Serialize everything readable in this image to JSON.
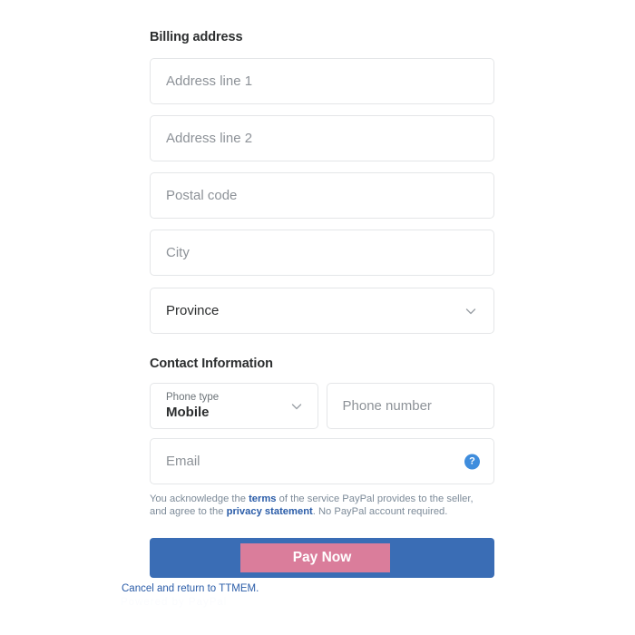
{
  "billing": {
    "title": "Billing address",
    "address_line_1_placeholder": "Address line 1",
    "address_line_2_placeholder": "Address line 2",
    "postal_code_placeholder": "Postal code",
    "city_placeholder": "City",
    "province_value": "Province",
    "province_icon": "chevron-down-icon"
  },
  "contact": {
    "title": "Contact Information",
    "phone_type_label": "Phone type",
    "phone_type_value": "Mobile",
    "phone_type_icon": "chevron-down-icon",
    "phone_number_placeholder": "Phone number",
    "email_placeholder": "Email",
    "email_help_icon": "help-icon",
    "email_help_glyph": "?"
  },
  "legal": {
    "part1": "You acknowledge the ",
    "terms_link": "terms",
    "part2": " of the service PayPal provides to the seller, and agree to the ",
    "privacy_link": "privacy statement",
    "part3": ". No PayPal account required."
  },
  "actions": {
    "pay_label": "Pay Now",
    "cancel_label": "Cancel and return to TTMEM.",
    "ghost_label": "Powered by PayPal"
  },
  "colors": {
    "pay_button_blue": "#3a6db5",
    "pay_highlight_pink": "#da7d9b",
    "link_blue": "#2a5ca8",
    "help_icon_blue": "#3f8ddd",
    "field_border": "#e4e6e8",
    "placeholder_grey": "#8d9298"
  }
}
